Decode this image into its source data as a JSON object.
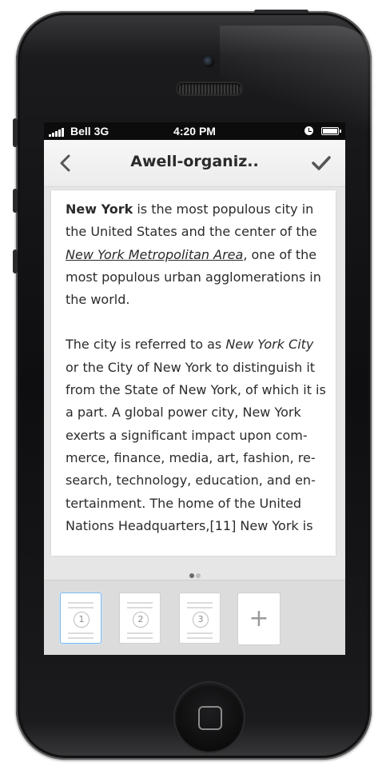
{
  "status_bar": {
    "carrier": "Bell 3G",
    "time": "4:20 PM"
  },
  "nav_bar": {
    "title": "Awell-organiz..",
    "back_icon": "chevron-left-icon",
    "done_icon": "checkmark-icon"
  },
  "article": {
    "p1_bold": "New York",
    "p1_text1": " is the most populous city in the United States and the center of the ",
    "p1_link": "New York Metropolitan Area",
    "p1_text2": ", one of the most populous urban agglomerations in the world.",
    "p2_text1": "The city is referred to as ",
    "p2_italic": "New York City",
    "p2_text2": " or the City of New York to distinguish it from the State of New York, of which it is a part. A global power city, New York exerts a significant impact upon com-merce, finance, media, art, fashion, re-search, technology, education, and en-tertainment. The home of the United Nations Headquarters,[11] New York is"
  },
  "pager": {
    "total": 2,
    "current": 1
  },
  "page_thumbnails": [
    {
      "number": "1",
      "selected": true
    },
    {
      "number": "2",
      "selected": false
    },
    {
      "number": "3",
      "selected": false
    }
  ],
  "add_page": {
    "label": "+"
  },
  "colors": {
    "selected_thumb_border": "#7fb8e6",
    "tray_background": "#dcdcdc"
  }
}
